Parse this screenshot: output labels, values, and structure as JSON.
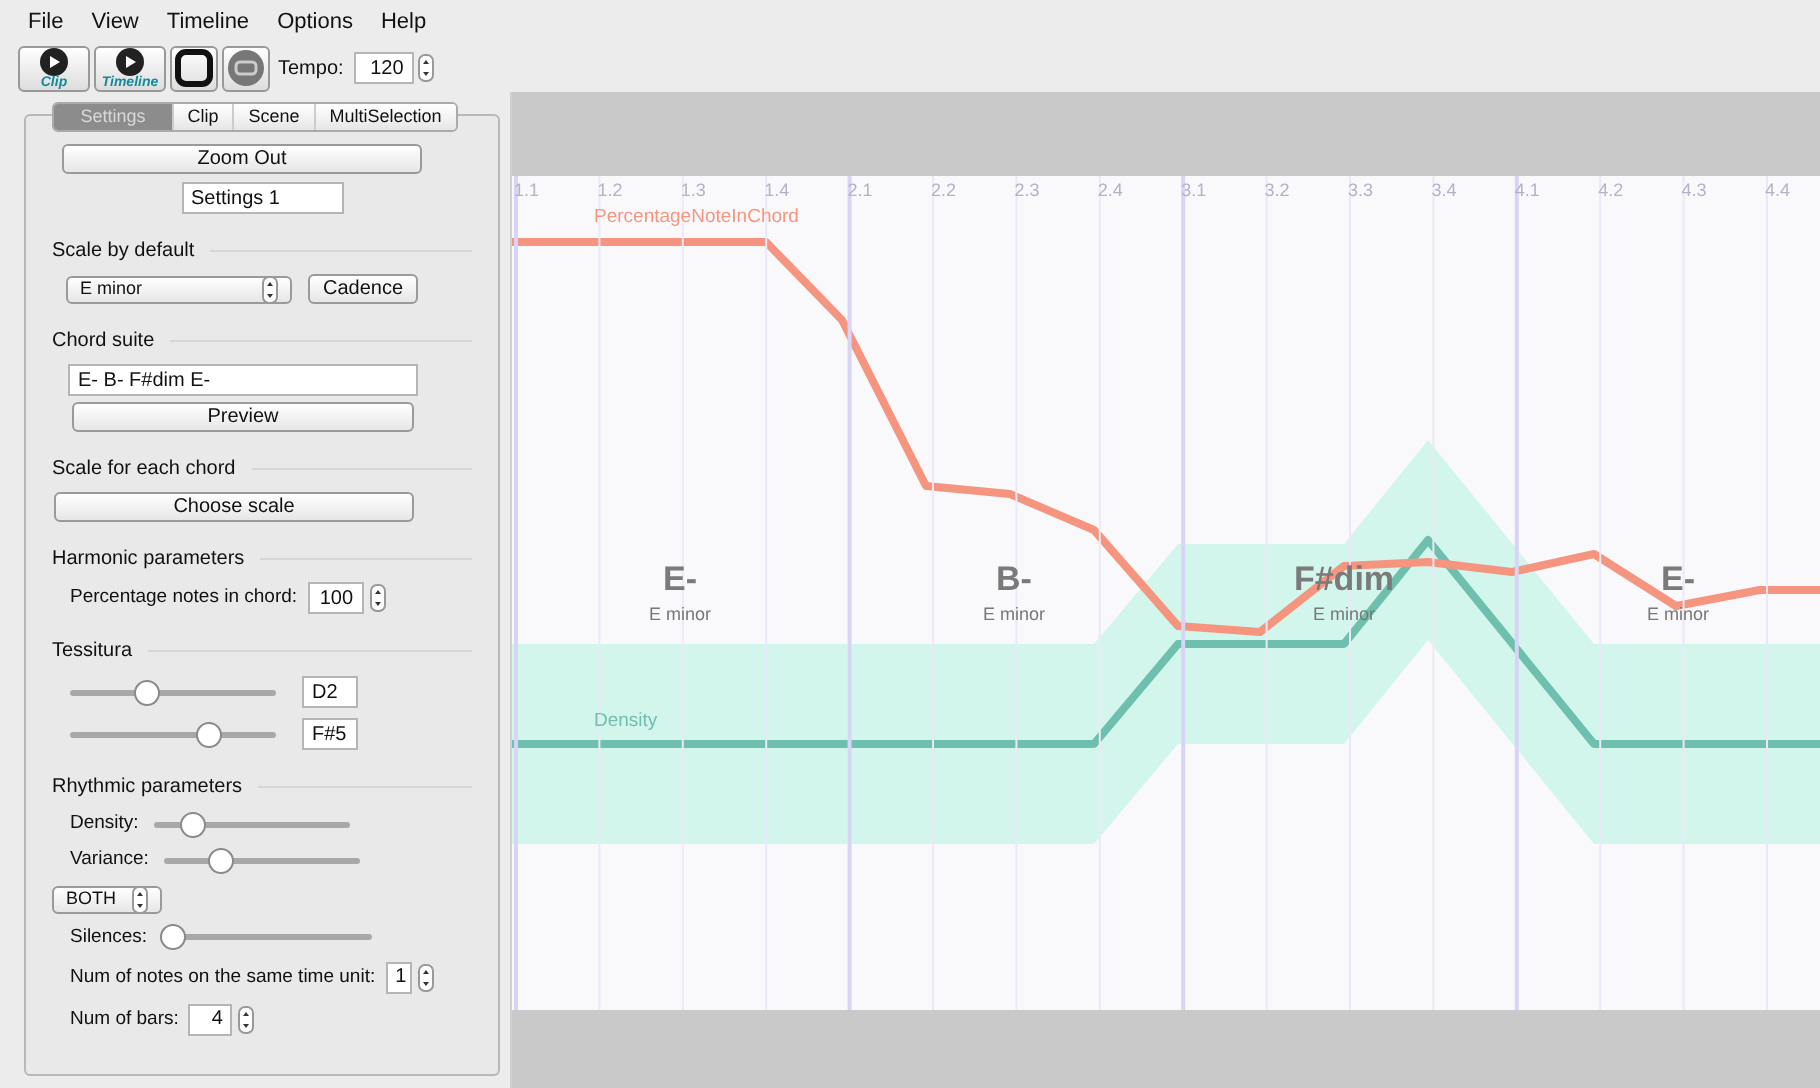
{
  "menu": [
    "File",
    "View",
    "Timeline",
    "Options",
    "Help"
  ],
  "toolbar": {
    "buttons": [
      {
        "kind": "play",
        "label": "Clip"
      },
      {
        "kind": "play",
        "label": "Timeline"
      },
      {
        "kind": "stop"
      },
      {
        "kind": "record"
      }
    ],
    "tempo_label": "Tempo:",
    "tempo": "120"
  },
  "tabs": [
    {
      "label": "Settings",
      "selected": true
    },
    {
      "label": "Clip",
      "selected": false
    },
    {
      "label": "Scene",
      "selected": false
    },
    {
      "label": "MultiSelection",
      "selected": false
    }
  ],
  "settings": {
    "zoom_button": "Zoom Out",
    "name": "Settings 1",
    "scale_section": "Scale by default",
    "scale": "E minor",
    "cadence_button": "Cadence",
    "chord_section": "Chord suite",
    "chord_suite": "E- B- F#dim E-",
    "preview_button": "Preview",
    "scale_each_section": "Scale for each chord",
    "choose_scale_button": "Choose scale",
    "harmonic_section": "Harmonic parameters",
    "percentage_label": "Percentage notes in chord:",
    "percentage": "100",
    "tessitura_section": "Tessitura",
    "tessitura": [
      {
        "level": 0.35,
        "value": "D2"
      },
      {
        "level": 0.7,
        "value": "F#5"
      }
    ],
    "rhythmic_section": "Rhythmic parameters",
    "rhythm_sliders": [
      {
        "label": "Density:",
        "level": 0.15
      },
      {
        "label": "Variance:",
        "level": 0.25
      }
    ],
    "mode": "BOTH",
    "silences": {
      "label": "Silences:",
      "level": 0.0
    },
    "notes_label": "Num of notes on the same time unit:",
    "notes": "1",
    "bars_label": "Num of bars:",
    "bars": "4"
  },
  "timeline": {
    "ticks": [
      "1.1",
      "1.2",
      "1.3",
      "1.4",
      "2.1",
      "2.2",
      "2.3",
      "2.4",
      "3.1",
      "3.2",
      "3.3",
      "3.4",
      "4.1",
      "4.2",
      "4.3",
      "4.4"
    ],
    "chords": [
      {
        "name": "E-",
        "scale": "E minor"
      },
      {
        "name": "B-",
        "scale": "E minor"
      },
      {
        "name": "F#dim",
        "scale": "E minor"
      },
      {
        "name": "E-",
        "scale": "E minor"
      }
    ],
    "curves": [
      {
        "kind": "percentage",
        "label": "PercentageNoteInChord",
        "color": "#f5957f"
      },
      {
        "kind": "density",
        "label": "Density",
        "color": "#6fbfae"
      }
    ]
  }
}
